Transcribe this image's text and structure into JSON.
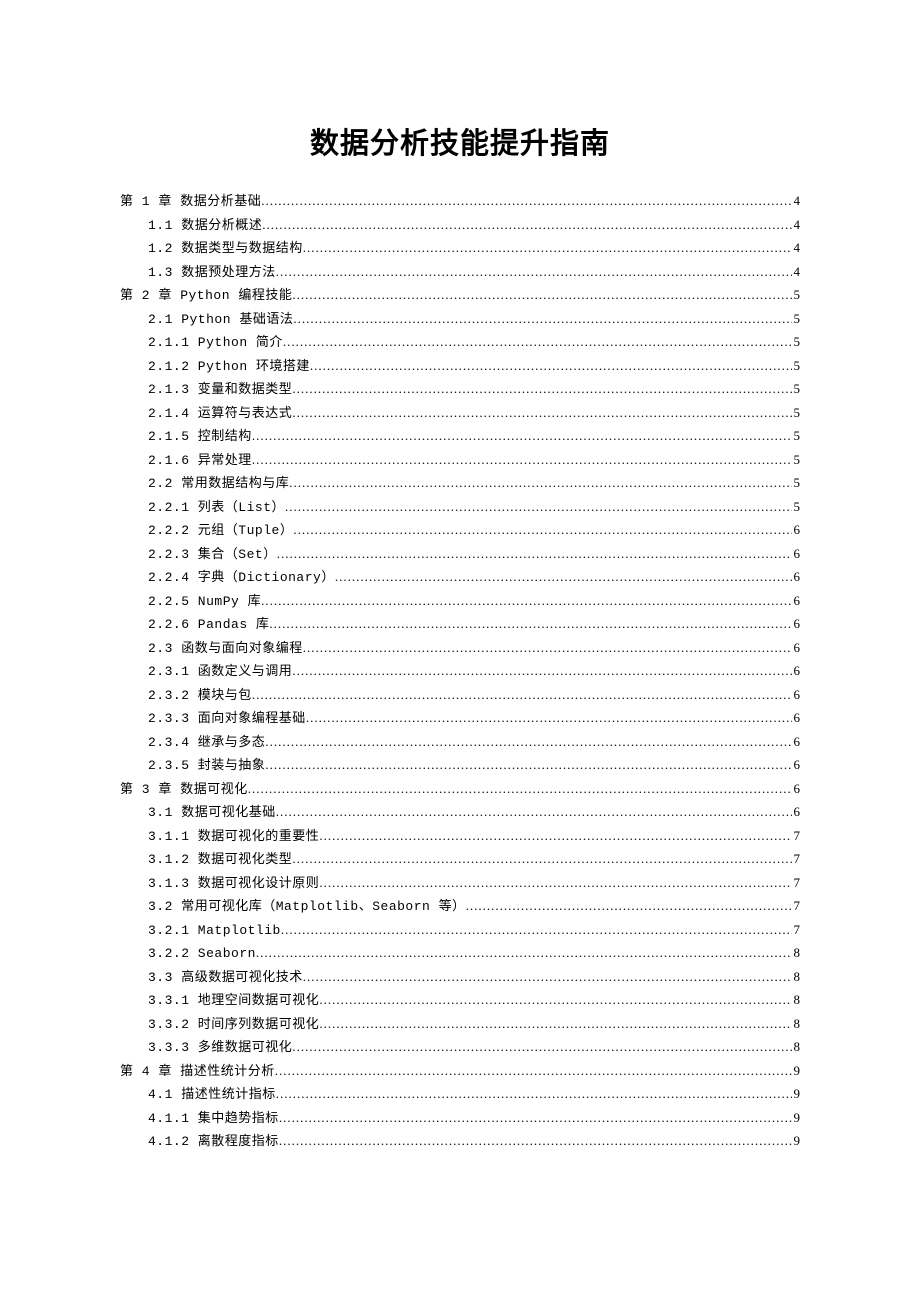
{
  "title": "数据分析技能提升指南",
  "toc": [
    {
      "indent": 0,
      "label": "第 1 章 数据分析基础",
      "page": "4"
    },
    {
      "indent": 1,
      "label": "1.1 数据分析概述",
      "page": "4"
    },
    {
      "indent": 1,
      "label": "1.2 数据类型与数据结构",
      "page": "4"
    },
    {
      "indent": 1,
      "label": "1.3 数据预处理方法",
      "page": "4"
    },
    {
      "indent": 0,
      "label": "第 2 章 Python 编程技能",
      "page": "5"
    },
    {
      "indent": 1,
      "label": "2.1 Python 基础语法",
      "page": "5"
    },
    {
      "indent": 1,
      "label": "2.1.1 Python 简介",
      "page": "5"
    },
    {
      "indent": 1,
      "label": "2.1.2 Python 环境搭建",
      "page": "5"
    },
    {
      "indent": 1,
      "label": "2.1.3 变量和数据类型",
      "page": "5"
    },
    {
      "indent": 1,
      "label": "2.1.4 运算符与表达式",
      "page": "5"
    },
    {
      "indent": 1,
      "label": "2.1.5 控制结构",
      "page": "5"
    },
    {
      "indent": 1,
      "label": "2.1.6 异常处理",
      "page": "5"
    },
    {
      "indent": 1,
      "label": "2.2 常用数据结构与库",
      "page": "5"
    },
    {
      "indent": 1,
      "label": "2.2.1 列表（List）",
      "page": "5"
    },
    {
      "indent": 1,
      "label": "2.2.2 元组（Tuple）",
      "page": "6"
    },
    {
      "indent": 1,
      "label": "2.2.3 集合（Set）",
      "page": "6"
    },
    {
      "indent": 1,
      "label": "2.2.4 字典（Dictionary）",
      "page": "6"
    },
    {
      "indent": 1,
      "label": "2.2.5 NumPy 库",
      "page": "6"
    },
    {
      "indent": 1,
      "label": "2.2.6 Pandas 库",
      "page": "6"
    },
    {
      "indent": 1,
      "label": "2.3 函数与面向对象编程",
      "page": "6"
    },
    {
      "indent": 1,
      "label": "2.3.1 函数定义与调用",
      "page": "6"
    },
    {
      "indent": 1,
      "label": "2.3.2 模块与包",
      "page": "6"
    },
    {
      "indent": 1,
      "label": "2.3.3 面向对象编程基础",
      "page": "6"
    },
    {
      "indent": 1,
      "label": "2.3.4 继承与多态",
      "page": "6"
    },
    {
      "indent": 1,
      "label": "2.3.5 封装与抽象",
      "page": "6"
    },
    {
      "indent": 0,
      "label": "第 3 章 数据可视化",
      "page": "6"
    },
    {
      "indent": 1,
      "label": "3.1 数据可视化基础",
      "page": "6"
    },
    {
      "indent": 1,
      "label": "3.1.1 数据可视化的重要性",
      "page": "7"
    },
    {
      "indent": 1,
      "label": "3.1.2 数据可视化类型",
      "page": "7"
    },
    {
      "indent": 1,
      "label": "3.1.3 数据可视化设计原则",
      "page": "7"
    },
    {
      "indent": 1,
      "label": "3.2 常用可视化库（Matplotlib、Seaborn 等）",
      "page": "7"
    },
    {
      "indent": 1,
      "label": "3.2.1 Matplotlib",
      "page": "7"
    },
    {
      "indent": 1,
      "label": "3.2.2 Seaborn",
      "page": "8"
    },
    {
      "indent": 1,
      "label": "3.3 高级数据可视化技术",
      "page": "8"
    },
    {
      "indent": 1,
      "label": "3.3.1 地理空间数据可视化",
      "page": "8"
    },
    {
      "indent": 1,
      "label": "3.3.2 时间序列数据可视化",
      "page": "8"
    },
    {
      "indent": 1,
      "label": "3.3.3 多维数据可视化",
      "page": "8"
    },
    {
      "indent": 0,
      "label": "第 4 章 描述性统计分析",
      "page": "9"
    },
    {
      "indent": 1,
      "label": "4.1 描述性统计指标",
      "page": "9"
    },
    {
      "indent": 1,
      "label": "4.1.1 集中趋势指标",
      "page": "9"
    },
    {
      "indent": 1,
      "label": "4.1.2 离散程度指标",
      "page": "9"
    }
  ]
}
